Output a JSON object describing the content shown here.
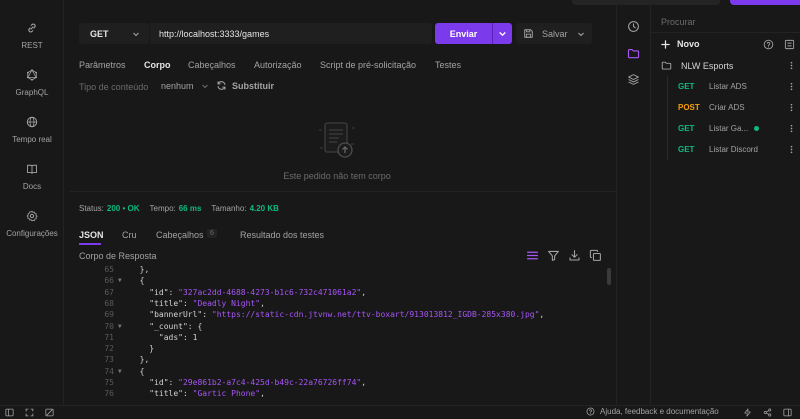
{
  "nav": {
    "items": [
      {
        "label": "REST",
        "icon": "link-icon"
      },
      {
        "label": "GraphQL",
        "icon": "graphql-icon"
      },
      {
        "label": "Tempo real",
        "icon": "globe-icon"
      },
      {
        "label": "Docs",
        "icon": "book-icon"
      },
      {
        "label": "Configurações",
        "icon": "gear-icon"
      }
    ]
  },
  "request": {
    "method": "GET",
    "url": "http://localhost:3333/games",
    "send_label": "Enviar",
    "save_label": "Salvar",
    "tabs": [
      "Parâmetros",
      "Corpo",
      "Cabeçalhos",
      "Autorização",
      "Script de pré-solicitação",
      "Testes"
    ],
    "active_tab": "Corpo",
    "content_type_label": "Tipo de conteúdo",
    "content_type_value": "nenhum",
    "replace_label": "Substituir",
    "empty_body_text": "Este pedido não tem corpo"
  },
  "response": {
    "status_label": "Status:",
    "status_value": "200  •  OK",
    "time_label": "Tempo:",
    "time_value": "66 ms",
    "size_label": "Tamanho:",
    "size_value": "4.20 KB",
    "tabs": [
      "JSON",
      "Cru",
      "Cabeçalhos",
      "Resultado dos testes"
    ],
    "headers_count": "6",
    "body_label": "Corpo de Resposta",
    "lines": [
      {
        "n": "65",
        "fold": "",
        "parts": [
          [
            "p",
            "  },"
          ]
        ]
      },
      {
        "n": "66",
        "fold": "▼",
        "parts": [
          [
            "p",
            "  {"
          ]
        ]
      },
      {
        "n": "67",
        "fold": "",
        "parts": [
          [
            "k",
            "    \"id\": "
          ],
          [
            "s",
            "\"327ac2dd-4688-4273-b1c6-732c471061a2\""
          ],
          [
            "p",
            ","
          ]
        ]
      },
      {
        "n": "68",
        "fold": "",
        "parts": [
          [
            "k",
            "    \"title\": "
          ],
          [
            "s",
            "\"Deadly Night\""
          ],
          [
            "p",
            ","
          ]
        ]
      },
      {
        "n": "69",
        "fold": "",
        "parts": [
          [
            "k",
            "    \"bannerUrl\": "
          ],
          [
            "s",
            "\"https://static-cdn.jtvnw.net/ttv-boxart/913013812_IGDB-285x380.jpg\""
          ],
          [
            "p",
            ","
          ]
        ]
      },
      {
        "n": "70",
        "fold": "▼",
        "parts": [
          [
            "k",
            "    \"_count\": "
          ],
          [
            "p",
            "{"
          ]
        ]
      },
      {
        "n": "71",
        "fold": "",
        "parts": [
          [
            "k",
            "      \"ads\": "
          ],
          [
            "p",
            "1"
          ]
        ]
      },
      {
        "n": "72",
        "fold": "",
        "parts": [
          [
            "p",
            "    }"
          ]
        ]
      },
      {
        "n": "73",
        "fold": "",
        "parts": [
          [
            "p",
            "  },"
          ]
        ]
      },
      {
        "n": "74",
        "fold": "▼",
        "parts": [
          [
            "p",
            "  {"
          ]
        ]
      },
      {
        "n": "75",
        "fold": "",
        "parts": [
          [
            "k",
            "    \"id\": "
          ],
          [
            "s",
            "\"29e861b2-a7c4-425d-b49c-22a76726ff74\""
          ],
          [
            "p",
            ","
          ]
        ]
      },
      {
        "n": "76",
        "fold": "",
        "parts": [
          [
            "k",
            "    \"title\": "
          ],
          [
            "s",
            "\"Gartic Phone\""
          ],
          [
            "p",
            ","
          ]
        ]
      }
    ]
  },
  "collections": {
    "search_placeholder": "Procurar",
    "new_label": "Novo",
    "collection_name": "NLW Esports",
    "requests": [
      {
        "method": "GET",
        "name": "Listar ADS",
        "active": false
      },
      {
        "method": "POST",
        "name": "Criar ADS",
        "active": false
      },
      {
        "method": "GET",
        "name": "Listar Ga...",
        "active": true
      },
      {
        "method": "GET",
        "name": "Listar Discord",
        "active": false
      }
    ]
  },
  "footer": {
    "help_label": "Ajuda, feedback e documentação"
  },
  "colors": {
    "accent": "#7c3aed",
    "success": "#10b981",
    "post": "#f59e0b",
    "string": "#a855f7"
  }
}
